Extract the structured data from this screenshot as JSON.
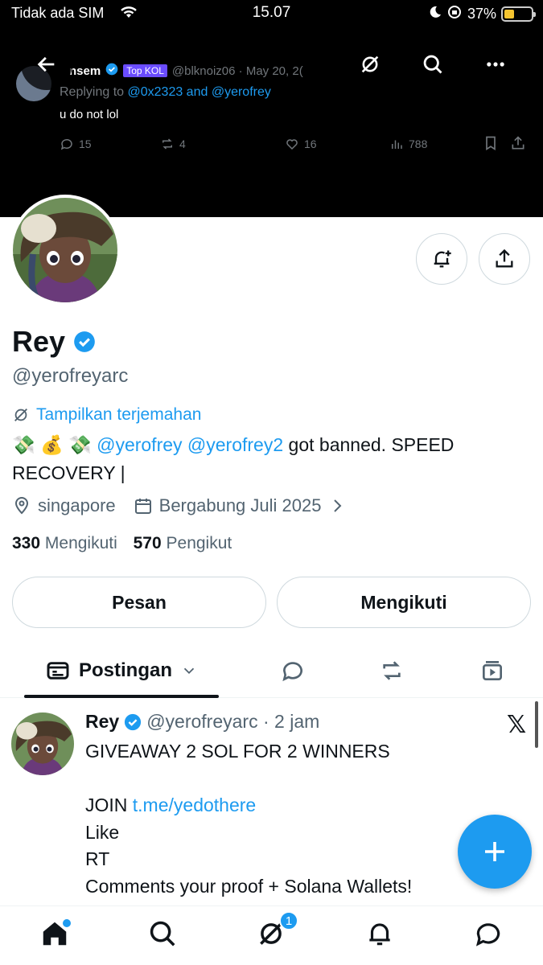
{
  "status_bar": {
    "carrier": "Tidak ada SIM",
    "time": "15.07",
    "battery": "37%",
    "battery_level": 0.37
  },
  "banner_post": {
    "name": "nsem",
    "badge": "Top KOL",
    "handle_date": "@blknoiz06 · May 20, 2(",
    "replying_prefix": "Replying to ",
    "replying_to": "@0x2323 and @yerofrey",
    "text": "u do not lol",
    "replies": "15",
    "reposts": "4",
    "likes": "16",
    "views": "788"
  },
  "profile": {
    "name": "Rey",
    "handle": "@yerofreyarc",
    "translate": "Tampilkan terjemahan",
    "bio_emojis": "💸 💰 💸",
    "bio_mention1": "@yerofrey",
    "bio_mention2": "@yerofrey2",
    "bio_text": " got banned. SPEED RECOVERY |",
    "location": "singapore",
    "joined": "Bergabung Juli 2025",
    "following_count": "330",
    "following_label": "Mengikuti",
    "followers_count": "570",
    "followers_label": "Pengikut",
    "message_button": "Pesan",
    "follow_button": "Mengikuti"
  },
  "tabs": {
    "active": "Postingan"
  },
  "post": {
    "name": "Rey",
    "handle_time": "@yerofreyarc · 2 jam",
    "line1": "GIVEAWAY 2 SOL FOR 2 WINNERS",
    "join_prefix": "JOIN ",
    "join_link": "t.me/yedothere",
    "line_like": "Like",
    "line_rt": "RT",
    "line_comments": "Comments your proof + Solana Wallets!"
  },
  "bottom_nav": {
    "grok_badge": "1"
  },
  "colors": {
    "accent": "#1d9bf0",
    "text": "#0f1419",
    "muted": "#536471"
  }
}
